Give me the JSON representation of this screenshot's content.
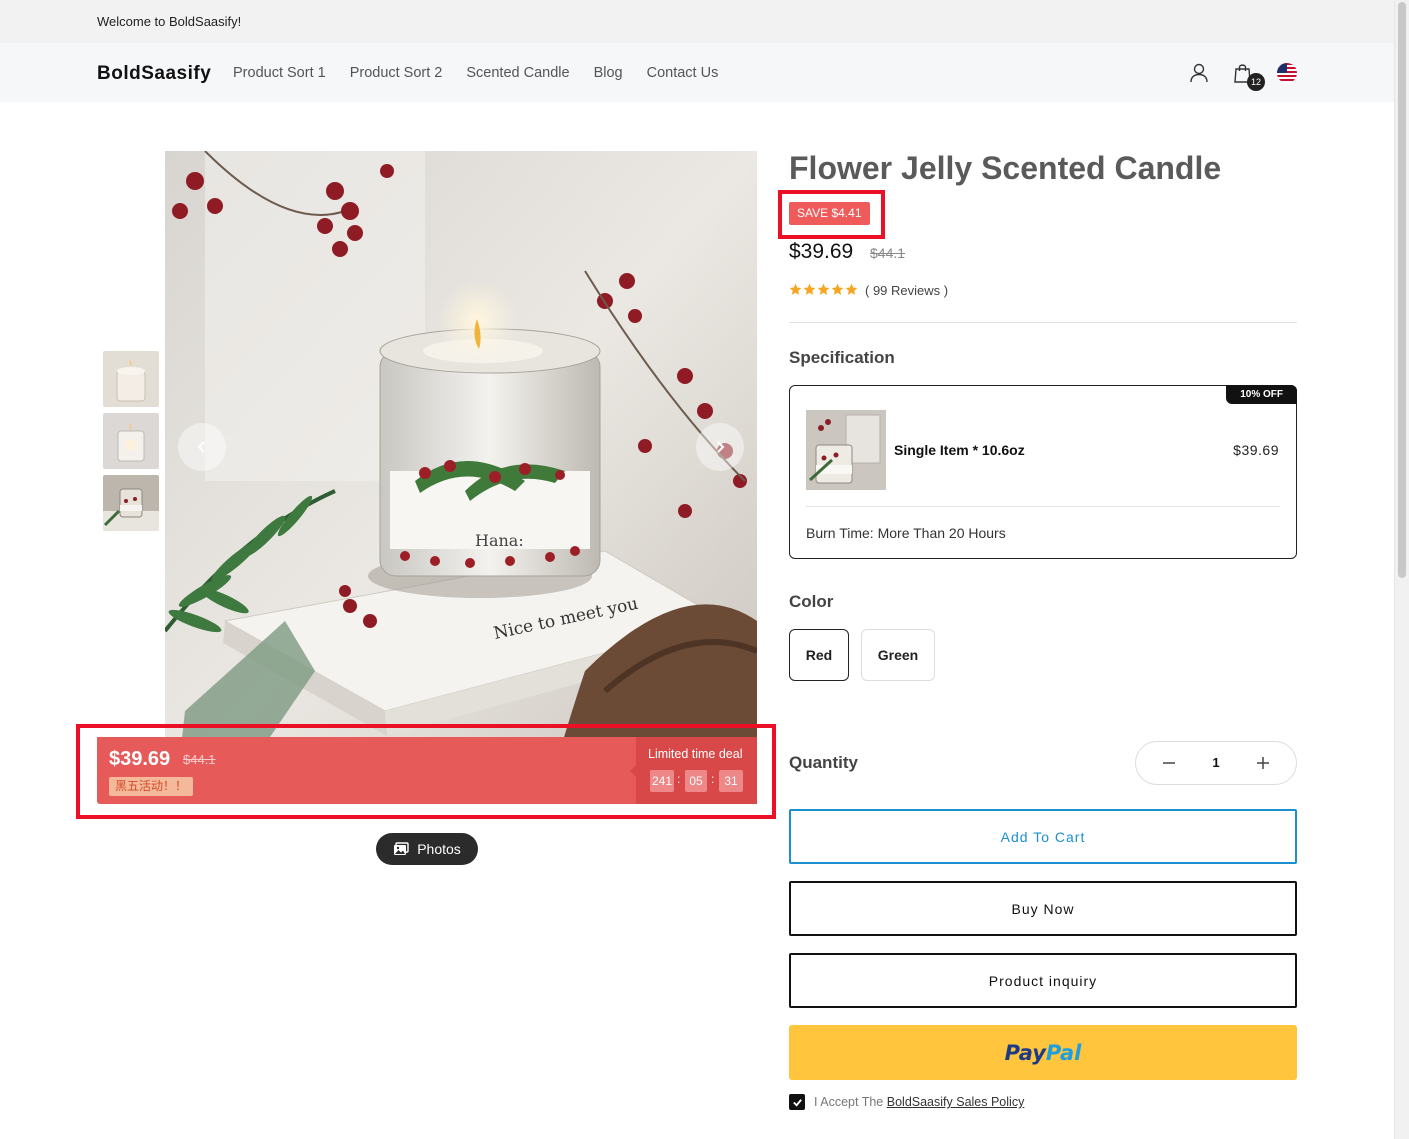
{
  "announcement": "Welcome to BoldSaasify!",
  "header": {
    "logo": "BoldSaasify",
    "nav": [
      "Product Sort 1",
      "Product Sort 2",
      "Scented Candle",
      "Blog",
      "Contact Us"
    ],
    "cart_count": "12",
    "icons": [
      "user-icon",
      "shopping-bag-icon",
      "us-flag-icon"
    ]
  },
  "gallery": {
    "thumbnails": [
      "candle-thumb-1",
      "candle-thumb-2",
      "candle-thumb-3"
    ],
    "active_thumbnail": 2,
    "photos_label": "Photos"
  },
  "deal": {
    "price": "$39.69",
    "old_price": "$44.1",
    "tag": "黑五活动！！",
    "limited_label": "Limited time deal",
    "countdown": [
      "241",
      "05",
      "31"
    ]
  },
  "product": {
    "title": "Flower Jelly Scented Candle",
    "save_badge": "SAVE $4.41",
    "price": "$39.69",
    "old_price": "$44.1",
    "rating": 5,
    "reviews": "( 99 Reviews )"
  },
  "specification": {
    "label": "Specification",
    "off_badge": "10% OFF",
    "item_name": "Single Item * 10.6oz",
    "item_price": "$39.69",
    "burn_time": "Burn Time: More Than 20 Hours"
  },
  "color": {
    "label": "Color",
    "options": [
      "Red",
      "Green"
    ],
    "selected": "Red"
  },
  "quantity": {
    "label": "Quantity",
    "value": "1"
  },
  "buttons": {
    "add_to_cart": "Add To Cart",
    "buy_now": "Buy Now",
    "inquiry": "Product inquiry",
    "paypal_1": "Pay",
    "paypal_2": "Pal"
  },
  "policy": {
    "prefix": "I Accept The",
    "link": "BoldSaasify Sales Policy"
  },
  "colors": {
    "deal_red": "#e65a5a",
    "save_red": "#ef5b5b",
    "cart_blue": "#1b8fcf",
    "paypal_yellow": "#ffc53d",
    "highlight": "#ec1027"
  }
}
